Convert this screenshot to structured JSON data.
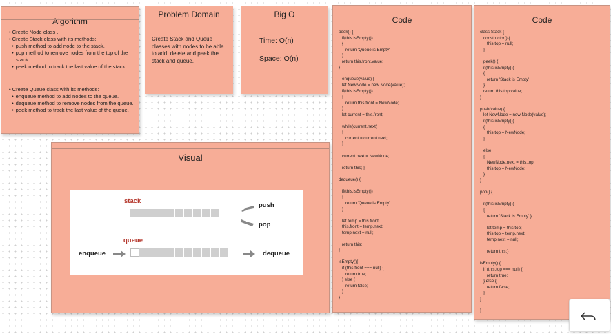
{
  "algorithm": {
    "title": "Algorithm",
    "items": [
      {
        "text": "Create Node class .",
        "level": 1
      },
      {
        "text": "Create Stack class with its methods:",
        "level": 1
      },
      {
        "text": "push method to add node to the stack.",
        "level": 2
      },
      {
        "text": "pop method to remove nodes from the top of the stack.",
        "level": 2
      },
      {
        "text": "peek method to track the last value of the stack.",
        "level": 2
      }
    ],
    "items2": [
      {
        "text": "Create Queue class with its methods:",
        "level": 1
      },
      {
        "text": "enqueue method to add nodes to the queue.",
        "level": 2
      },
      {
        "text": "dequeue method to remove nodes from the queue.",
        "level": 2
      },
      {
        "text": "peek method to track the last value of the queue.",
        "level": 2
      }
    ]
  },
  "problem_domain": {
    "title": "Problem Domain",
    "body": "Create Stack and Queue classes with nodes to be able to add, delete and peek the stack and queue."
  },
  "big_o": {
    "title": "Big O",
    "time": "Time: O(n)",
    "space": "Space: O(n)"
  },
  "visual": {
    "title": "Visual",
    "labels": {
      "stack": "stack",
      "push": "push",
      "pop": "pop",
      "queue": "queue",
      "enqueue": "enqueue",
      "dequeue": "dequeue"
    }
  },
  "code1": {
    "title": "Code",
    "lines": [
      {
        "t": "peek() {",
        "i": 0
      },
      {
        "t": "if(this.isEmpty())",
        "i": 1
      },
      {
        "t": "{",
        "i": 1
      },
      {
        "t": "return 'Queue is Empty'",
        "i": 2
      },
      {
        "t": "}",
        "i": 1
      },
      {
        "t": "return this.front.value;",
        "i": 1
      },
      {
        "t": "}",
        "i": 0
      },
      {
        "t": "",
        "i": 0
      },
      {
        "t": "enqueue(value) {",
        "i": 1
      },
      {
        "t": "let NewNode = new Node(value);",
        "i": 1
      },
      {
        "t": "if(this.isEmpty())",
        "i": 1
      },
      {
        "t": "{",
        "i": 1
      },
      {
        "t": "return this.front = NewNode;",
        "i": 2
      },
      {
        "t": "}",
        "i": 1
      },
      {
        "t": "let current = this.front;",
        "i": 1
      },
      {
        "t": "",
        "i": 0
      },
      {
        "t": "while(current.next)",
        "i": 1
      },
      {
        "t": "{",
        "i": 1
      },
      {
        "t": "current = current.next;",
        "i": 2
      },
      {
        "t": "}",
        "i": 1
      },
      {
        "t": "",
        "i": 0
      },
      {
        "t": "current.next = NewNode;",
        "i": 1
      },
      {
        "t": "",
        "i": 0
      },
      {
        "t": "return this; }",
        "i": 1
      },
      {
        "t": "",
        "i": 0
      },
      {
        "t": "dequeue() {",
        "i": 0
      },
      {
        "t": "",
        "i": 0
      },
      {
        "t": "if(this.isEmpty())",
        "i": 1
      },
      {
        "t": "{",
        "i": 1
      },
      {
        "t": "return 'Queue is Empty'",
        "i": 2
      },
      {
        "t": "}",
        "i": 1
      },
      {
        "t": "",
        "i": 0
      },
      {
        "t": "let temp = this.front;",
        "i": 1
      },
      {
        "t": "this.front = temp.next;",
        "i": 1
      },
      {
        "t": "temp.next = null;",
        "i": 1
      },
      {
        "t": "",
        "i": 0
      },
      {
        "t": "return this;",
        "i": 1
      },
      {
        "t": "}",
        "i": 0
      },
      {
        "t": "",
        "i": 0
      },
      {
        "t": "isEmpty(){",
        "i": 0
      },
      {
        "t": "if (this.front === null) {",
        "i": 1
      },
      {
        "t": "return true;",
        "i": 2
      },
      {
        "t": "} else {",
        "i": 1
      },
      {
        "t": "return false;",
        "i": 2
      },
      {
        "t": "}",
        "i": 1
      },
      {
        "t": "}",
        "i": 0
      }
    ]
  },
  "code2": {
    "title": "Code",
    "lines": [
      {
        "t": "class Stack {",
        "i": 0
      },
      {
        "t": "constructor() {",
        "i": 1
      },
      {
        "t": "this.top = null;",
        "i": 2
      },
      {
        "t": "}",
        "i": 1
      },
      {
        "t": "",
        "i": 0
      },
      {
        "t": "peek() {",
        "i": 1
      },
      {
        "t": "if(this.isEmpty())",
        "i": 1
      },
      {
        "t": "{",
        "i": 1
      },
      {
        "t": "return 'Stack is Empty'",
        "i": 2
      },
      {
        "t": "}",
        "i": 1
      },
      {
        "t": "return this.top.value;",
        "i": 1
      },
      {
        "t": "}",
        "i": 0
      },
      {
        "t": "",
        "i": 0
      },
      {
        "t": "push(value) {",
        "i": 0
      },
      {
        "t": "let NewNode = new Node(value);",
        "i": 1
      },
      {
        "t": "if(this.isEmpty())",
        "i": 1
      },
      {
        "t": "{",
        "i": 1
      },
      {
        "t": "this.top = NewNode;",
        "i": 2
      },
      {
        "t": "}",
        "i": 1
      },
      {
        "t": "",
        "i": 0
      },
      {
        "t": "else",
        "i": 1
      },
      {
        "t": "{",
        "i": 1
      },
      {
        "t": "NewNode.next = this.top;",
        "i": 2
      },
      {
        "t": "this.top = NewNode;",
        "i": 2
      },
      {
        "t": "}",
        "i": 1
      },
      {
        "t": "}",
        "i": 0
      },
      {
        "t": "",
        "i": 0
      },
      {
        "t": "pop() {",
        "i": 0
      },
      {
        "t": "",
        "i": 0
      },
      {
        "t": "if(this.isEmpty())",
        "i": 1
      },
      {
        "t": "{",
        "i": 1
      },
      {
        "t": "return 'Stack is Empty' }",
        "i": 2
      },
      {
        "t": "",
        "i": 0
      },
      {
        "t": "let temp = this.top;",
        "i": 2
      },
      {
        "t": "this.top = temp.next;",
        "i": 2
      },
      {
        "t": "temp.next = null;",
        "i": 2
      },
      {
        "t": "",
        "i": 0
      },
      {
        "t": "return this;}",
        "i": 2
      },
      {
        "t": "",
        "i": 0
      },
      {
        "t": "isEmpty() {",
        "i": 0
      },
      {
        "t": "if (this.top === null) {",
        "i": 1
      },
      {
        "t": "return true;",
        "i": 2
      },
      {
        "t": "} else {",
        "i": 1
      },
      {
        "t": "return false;",
        "i": 2
      },
      {
        "t": "}",
        "i": 1
      },
      {
        "t": "}",
        "i": 0
      },
      {
        "t": "",
        "i": 0
      },
      {
        "t": "}",
        "i": 0
      }
    ]
  },
  "nav": {
    "back_icon": "undo-arrow-icon"
  }
}
